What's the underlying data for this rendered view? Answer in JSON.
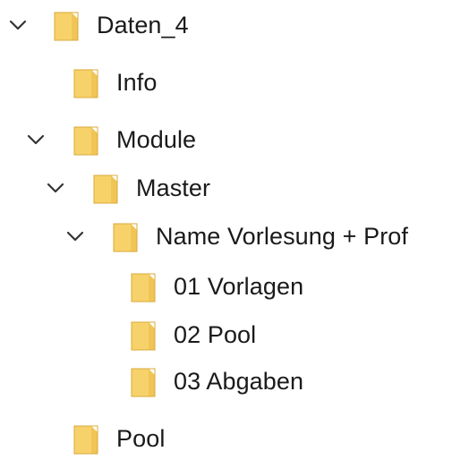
{
  "tree": {
    "nodes": [
      {
        "name": "Daten_4",
        "expanded": true,
        "has_chevron": true,
        "icon": "folder-icon"
      },
      {
        "name": "Info",
        "expanded": false,
        "has_chevron": false,
        "icon": "folder-icon"
      },
      {
        "name": "Module",
        "expanded": true,
        "has_chevron": true,
        "icon": "folder-icon"
      },
      {
        "name": "Master",
        "expanded": true,
        "has_chevron": true,
        "icon": "folder-icon"
      },
      {
        "name": "Name Vorlesung + Prof",
        "expanded": true,
        "has_chevron": true,
        "icon": "folder-icon"
      },
      {
        "name": "01 Vorlagen",
        "expanded": false,
        "has_chevron": false,
        "icon": "folder-icon"
      },
      {
        "name": "02 Pool",
        "expanded": false,
        "has_chevron": false,
        "icon": "folder-icon"
      },
      {
        "name": "03 Abgaben",
        "expanded": false,
        "has_chevron": false,
        "icon": "folder-icon"
      },
      {
        "name": "Pool",
        "expanded": false,
        "has_chevron": false,
        "icon": "folder-icon"
      }
    ]
  },
  "colors": {
    "folder_body": "#F7D26B",
    "folder_back": "#E9B94A",
    "folder_edge": "#D9A93A",
    "chevron": "#333333",
    "text": "#1A1A1A"
  }
}
